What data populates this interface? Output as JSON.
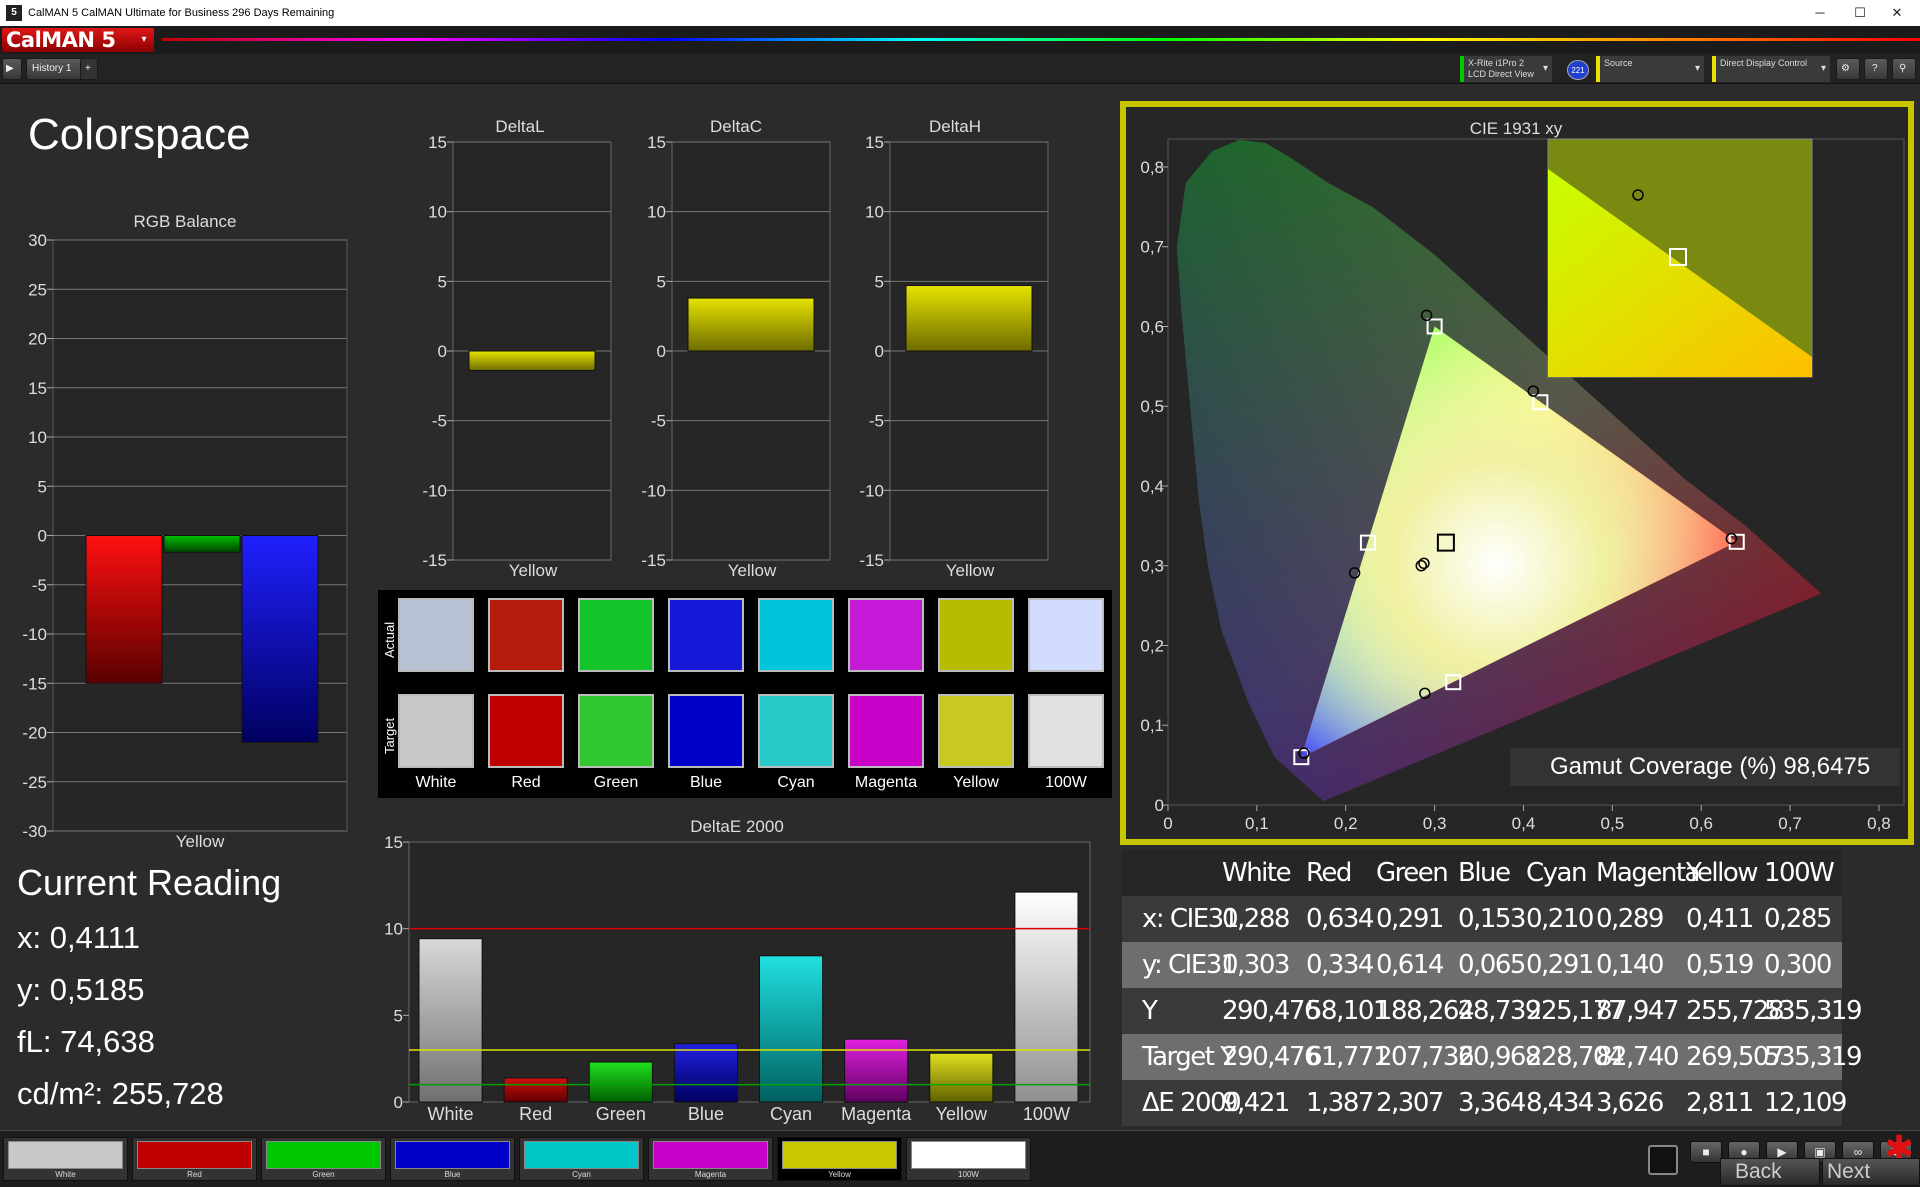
{
  "window": {
    "title": "CalMAN 5 CalMAN Ultimate for Business 296 Days Remaining",
    "app_icon": "5",
    "controls": [
      "─",
      "☐",
      "✕"
    ]
  },
  "menubar": {
    "logo": "CalMAN 5",
    "logo_menu_icon": "chevron-down-icon"
  },
  "tabbar": {
    "play_icon": "play-icon",
    "history_tab": "History 1",
    "add_tab": "+",
    "meter_line1": "X-Rite i1Pro 2",
    "meter_line2": "LCD Direct View",
    "meter_badge": "221",
    "source_label": "Source",
    "display_label": "Direct Display Control",
    "icons": [
      "gear-icon",
      "help-icon",
      "pin-icon"
    ]
  },
  "colors": {
    "accent_yellow": "#c7c400",
    "red": "#c00000",
    "green": "#00c800",
    "blue": "#0000c8"
  },
  "page": {
    "title": "Colorspace"
  },
  "rgb_balance": {
    "title": "RGB Balance",
    "category": "Yellow",
    "yticks": [
      "30",
      "25",
      "20",
      "15",
      "10",
      "5",
      "0",
      "-5",
      "-10",
      "-15",
      "-20",
      "-25",
      "-30"
    ]
  },
  "delta_charts": {
    "yticks": [
      "15",
      "10",
      "5",
      "0",
      "-5",
      "-10",
      "-15"
    ],
    "category": "Yellow",
    "titles": [
      "DeltaL",
      "DeltaC",
      "DeltaH"
    ]
  },
  "swatches": {
    "actual_label": "Actual",
    "target_label": "Target",
    "names": [
      "White",
      "Red",
      "Green",
      "Blue",
      "Cyan",
      "Magenta",
      "Yellow",
      "100W"
    ],
    "actual_colors": [
      "#b8c2d4",
      "#b51a0a",
      "#12c428",
      "#1818d8",
      "#00c4dc",
      "#c41ad8",
      "#b8bc00",
      "#d2dcff"
    ],
    "target_colors": [
      "#c8c8c8",
      "#c00000",
      "#30c830",
      "#0000c8",
      "#28c8c8",
      "#c800c8",
      "#c8c820",
      "#e0e0e0"
    ]
  },
  "deltae": {
    "title": "DeltaE 2000",
    "yticks": [
      "15",
      "10",
      "5",
      "0"
    ],
    "categories": [
      "White",
      "Red",
      "Green",
      "Blue",
      "Cyan",
      "Magenta",
      "Yellow",
      "100W"
    ]
  },
  "current_reading": {
    "title": "Current Reading",
    "x": "x: 0,4111",
    "y": "y: 0,5185",
    "fl": "fL: 74,638",
    "cdm2": "cd/m²: 255,728"
  },
  "cie": {
    "title": "CIE 1931 xy",
    "gamut_coverage": "Gamut Coverage (%) 98,6475",
    "xticks": [
      "0",
      "0,1",
      "0,2",
      "0,3",
      "0,4",
      "0,5",
      "0,6",
      "0,7",
      "0,8"
    ],
    "yticks": [
      "0,8",
      "0,7",
      "0,6",
      "0,5",
      "0,4",
      "0,3",
      "0,2",
      "0,1",
      "0"
    ]
  },
  "table": {
    "headers": [
      "White",
      "Red",
      "Green",
      "Blue",
      "Cyan",
      "Magenta",
      "Yellow",
      "100W"
    ],
    "rows": [
      {
        "label": "x: CIE31",
        "values": [
          "0,288",
          "0,634",
          "0,291",
          "0,153",
          "0,210",
          "0,289",
          "0,411",
          "0,285"
        ]
      },
      {
        "label": "y: CIE31",
        "values": [
          "0,303",
          "0,334",
          "0,614",
          "0,065",
          "0,291",
          "0,140",
          "0,519",
          "0,300"
        ]
      },
      {
        "label": "Y",
        "values": [
          "290,476",
          "58,101",
          "188,264",
          "28,739",
          "225,177",
          "87,947",
          "255,728",
          "535,319"
        ]
      },
      {
        "label": "Target Y",
        "values": [
          "290,476",
          "61,771",
          "207,736",
          "20,968",
          "228,704",
          "82,740",
          "269,507",
          "535,319"
        ]
      },
      {
        "label": "ΔE 2000",
        "values": [
          "9,421",
          "1,387",
          "2,307",
          "3,364",
          "8,434",
          "3,626",
          "2,811",
          "12,109"
        ]
      }
    ]
  },
  "bottombar": {
    "swatches": [
      {
        "label": "White",
        "color": "#c8c8c8"
      },
      {
        "label": "Red",
        "color": "#c00000"
      },
      {
        "label": "Green",
        "color": "#00c800"
      },
      {
        "label": "Blue",
        "color": "#0000c8"
      },
      {
        "label": "Cyan",
        "color": "#00c8c8"
      },
      {
        "label": "Magenta",
        "color": "#c800c8"
      },
      {
        "label": "Yellow",
        "color": "#c8c800"
      },
      {
        "label": "100W",
        "color": "#ffffff"
      }
    ],
    "back": "Back",
    "next": "Next",
    "controls": [
      "stop-icon",
      "record-icon",
      "play-icon",
      "save-icon",
      "link-icon",
      "refresh-icon"
    ]
  },
  "chart_data": [
    {
      "type": "bar",
      "title": "RGB Balance",
      "categories": [
        "Yellow"
      ],
      "series": [
        {
          "name": "Red",
          "values": [
            -15
          ]
        },
        {
          "name": "Green",
          "values": [
            -1.7
          ]
        },
        {
          "name": "Blue",
          "values": [
            -21
          ]
        }
      ],
      "ylim": [
        -30,
        30
      ]
    },
    {
      "type": "bar",
      "title": "DeltaL",
      "categories": [
        "Yellow"
      ],
      "values": [
        -1.4
      ],
      "ylim": [
        -15,
        15
      ]
    },
    {
      "type": "bar",
      "title": "DeltaC",
      "categories": [
        "Yellow"
      ],
      "values": [
        3.8
      ],
      "ylim": [
        -15,
        15
      ]
    },
    {
      "type": "bar",
      "title": "DeltaH",
      "categories": [
        "Yellow"
      ],
      "values": [
        4.7
      ],
      "ylim": [
        -15,
        15
      ]
    },
    {
      "type": "bar",
      "title": "DeltaE 2000",
      "categories": [
        "White",
        "Red",
        "Green",
        "Blue",
        "Cyan",
        "Magenta",
        "Yellow",
        "100W"
      ],
      "values": [
        9.421,
        1.387,
        2.307,
        3.364,
        8.434,
        3.626,
        2.811,
        12.109
      ],
      "ylim": [
        0,
        15
      ],
      "reference_lines": [
        10,
        3,
        1
      ]
    },
    {
      "type": "scatter",
      "title": "CIE 1931 xy",
      "xlim": [
        0,
        0.8
      ],
      "ylim": [
        0,
        0.8
      ],
      "targets": [
        {
          "name": "Red",
          "x": 0.64,
          "y": 0.33
        },
        {
          "name": "Green",
          "x": 0.3,
          "y": 0.6
        },
        {
          "name": "Blue",
          "x": 0.15,
          "y": 0.06
        },
        {
          "name": "White",
          "x": 0.3127,
          "y": 0.329
        },
        {
          "name": "Cyan",
          "x": 0.225,
          "y": 0.329
        },
        {
          "name": "Magenta",
          "x": 0.321,
          "y": 0.154
        },
        {
          "name": "Yellow",
          "x": 0.419,
          "y": 0.505
        }
      ],
      "measured": [
        {
          "name": "White",
          "x": 0.288,
          "y": 0.303
        },
        {
          "name": "Red",
          "x": 0.634,
          "y": 0.334
        },
        {
          "name": "Green",
          "x": 0.291,
          "y": 0.614
        },
        {
          "name": "Blue",
          "x": 0.153,
          "y": 0.065
        },
        {
          "name": "Cyan",
          "x": 0.21,
          "y": 0.291
        },
        {
          "name": "Magenta",
          "x": 0.289,
          "y": 0.14
        },
        {
          "name": "Yellow",
          "x": 0.411,
          "y": 0.519
        },
        {
          "name": "100W",
          "x": 0.285,
          "y": 0.3
        }
      ]
    }
  ]
}
